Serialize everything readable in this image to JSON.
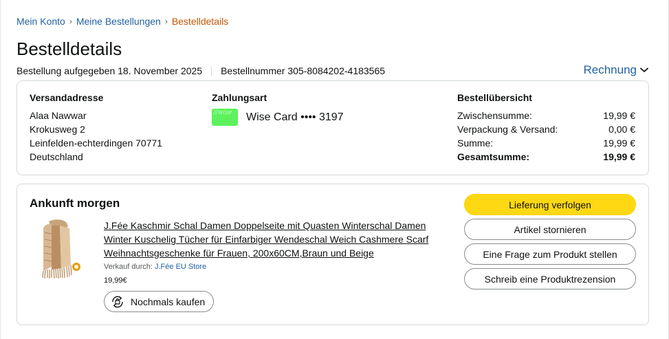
{
  "breadcrumb": {
    "items": [
      "Mein Konto",
      "Meine Bestellungen"
    ],
    "current": "Bestelldetails",
    "separator": "›"
  },
  "page_title": "Bestelldetails",
  "order_meta": {
    "placed": "Bestellung aufgegeben 18. November 2025",
    "number": "Bestellnummer 305-8084202-4183565"
  },
  "invoice": {
    "label": "Rechnung",
    "icon": "chevron-down-icon"
  },
  "shipping": {
    "title": "Versandadresse",
    "lines": [
      "Alaa Nawwar",
      "Krokusweg 2",
      "Leinfelden-echterdingen 70771",
      "Deutschland"
    ]
  },
  "payment": {
    "title": "Zahlungsart",
    "card_watermark": "//wise",
    "card_text": "Wise Card •••• 3197",
    "card_color": "#5df25d"
  },
  "summary": {
    "title": "Bestellübersicht",
    "rows": [
      {
        "label": "Zwischensumme:",
        "value": "19,99 €"
      },
      {
        "label": "Verpackung & Versand:",
        "value": "0,00 €"
      },
      {
        "label": "Summe:",
        "value": "19,99 €"
      },
      {
        "label": "Gesamtsumme:",
        "value": "19,99 €"
      }
    ]
  },
  "shipment": {
    "arrival": "Ankunft morgen",
    "product_title": "J.Fée Kaschmir Schal Damen Doppelseite mit Quasten Winterschal Damen Winter Kuschelig Tücher für Einfarbiger Wendeschal Weich Cashmere Scarf Weihnachtsgeschenke für Frauen, 200x60CM,Braun und Beige",
    "seller_prefix": "Verkauf durch:",
    "seller_name": "J.Fée EU Store",
    "price": "19,99€",
    "rebuy_label": "Nochmals kaufen",
    "buttons": {
      "track": "Lieferung verfolgen",
      "cancel": "Artikel stornieren",
      "question": "Eine Frage zum Produkt stellen",
      "review": "Schreib eine Produktrezension"
    }
  },
  "colors": {
    "link": "#2162a1",
    "breadcrumb_current": "#c45500",
    "primary_button": "#ffd814",
    "border": "#d5d9d9"
  }
}
